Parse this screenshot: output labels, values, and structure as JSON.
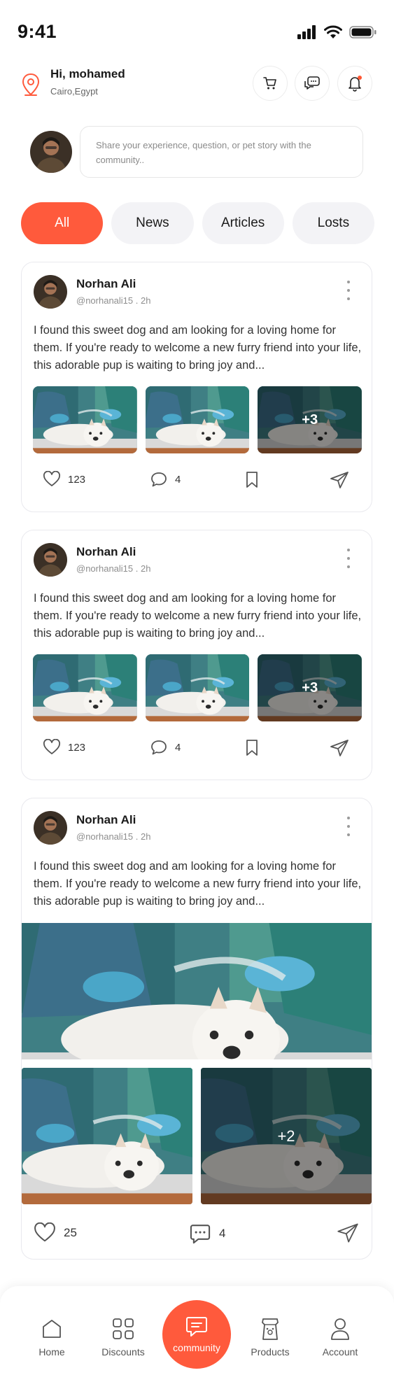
{
  "status_bar": {
    "time": "9:41"
  },
  "header": {
    "greeting": "Hi, mohamed",
    "location": "Cairo,Egypt",
    "icons": [
      "cart-icon",
      "chat-icon",
      "bell-icon"
    ]
  },
  "composer": {
    "placeholder": "Share your experience, question, or pet story with the community.."
  },
  "tabs": [
    {
      "label": "All",
      "active": true
    },
    {
      "label": "News",
      "active": false
    },
    {
      "label": "Articles",
      "active": false
    },
    {
      "label": "Losts",
      "active": false
    }
  ],
  "posts": [
    {
      "author": "Norhan Ali",
      "handle": "@norhanali15 . 2h",
      "text": "I found this sweet dog and am looking for a loving home for them. If you're ready to welcome a new furry friend into your life, this adorable pup is waiting to bring joy and...",
      "more_images": "+3",
      "likes": "123",
      "comments": "4"
    },
    {
      "author": "Norhan Ali",
      "handle": "@norhanali15 . 2h",
      "text": "I found this sweet dog and am looking for a loving home for them. If you're ready to welcome a new furry friend into your life, this adorable pup is waiting to bring joy and...",
      "more_images": "+3",
      "likes": "123",
      "comments": "4"
    },
    {
      "author": "Norhan Ali",
      "handle": "@norhanali15 . 2h",
      "text": "I found this sweet dog and am looking for a loving home for them. If you're ready to welcome a new furry friend into your life, this adorable pup is waiting to bring joy and...",
      "more_images": "+2",
      "likes": "25",
      "comments": "4"
    }
  ],
  "bottom_nav": {
    "items": [
      "Home",
      "Discounts",
      "community",
      "Products",
      "Account"
    ],
    "active": "community"
  },
  "colors": {
    "accent": "#ff5a3c",
    "tab_bg": "#f3f3f6"
  }
}
